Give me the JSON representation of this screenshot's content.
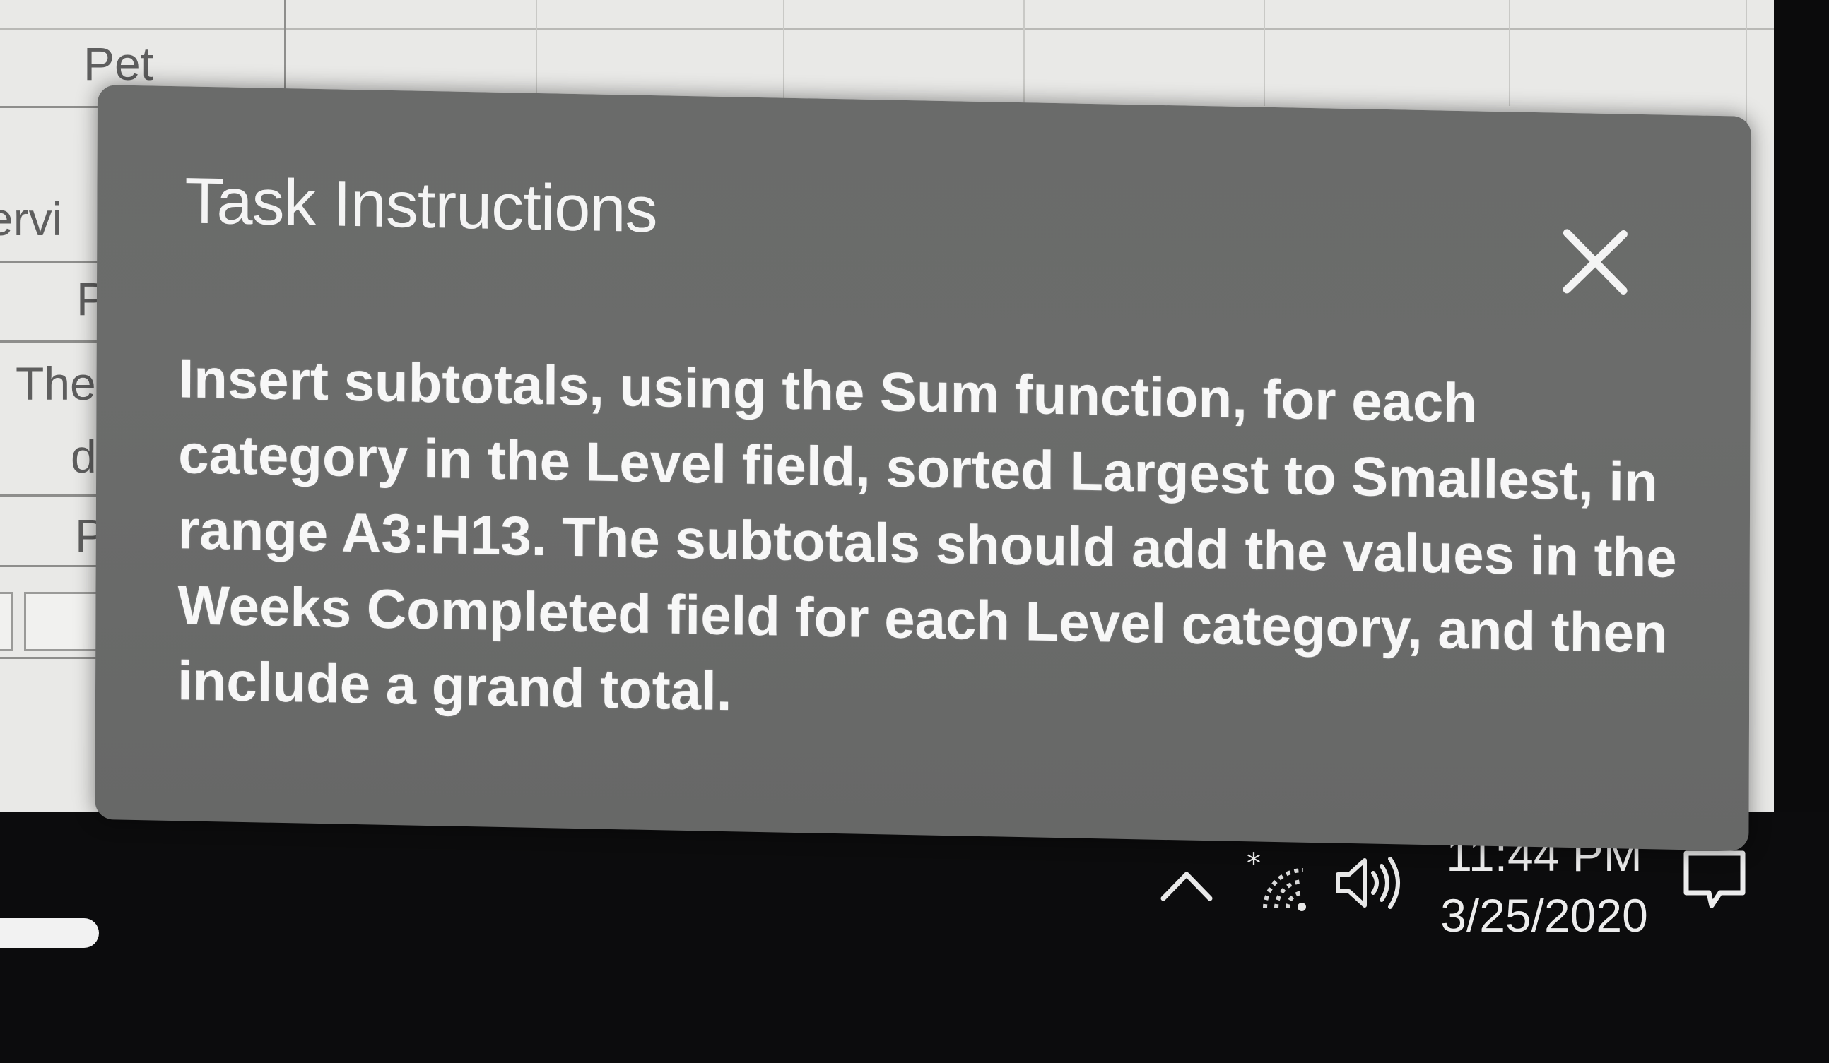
{
  "spreadsheet": {
    "visible_cells": [
      {
        "id": "pet",
        "text": "Pet"
      },
      {
        "id": "servi",
        "text": "ervi"
      },
      {
        "id": "p1",
        "text": "P"
      },
      {
        "id": "the",
        "text": "The"
      },
      {
        "id": "d",
        "text": "d"
      },
      {
        "id": "p2",
        "text": "P"
      }
    ]
  },
  "dialog": {
    "title": "Task Instructions",
    "close_icon": "close-icon",
    "body": "Insert subtotals, using the Sum function, for each\ncategory in the Level field, sorted Largest to Smallest, in\nrange A3:H13. The subtotals should add the values in the\nWeeks Completed field for each Level category, and then\ninclude a grand total."
  },
  "taskbar": {
    "tray_icons": [
      "chevron-up-icon",
      "wifi-icon",
      "speaker-icon"
    ],
    "time": "11:44 PM",
    "date": "3/25/2020",
    "notifications_icon": "notification-icon"
  }
}
